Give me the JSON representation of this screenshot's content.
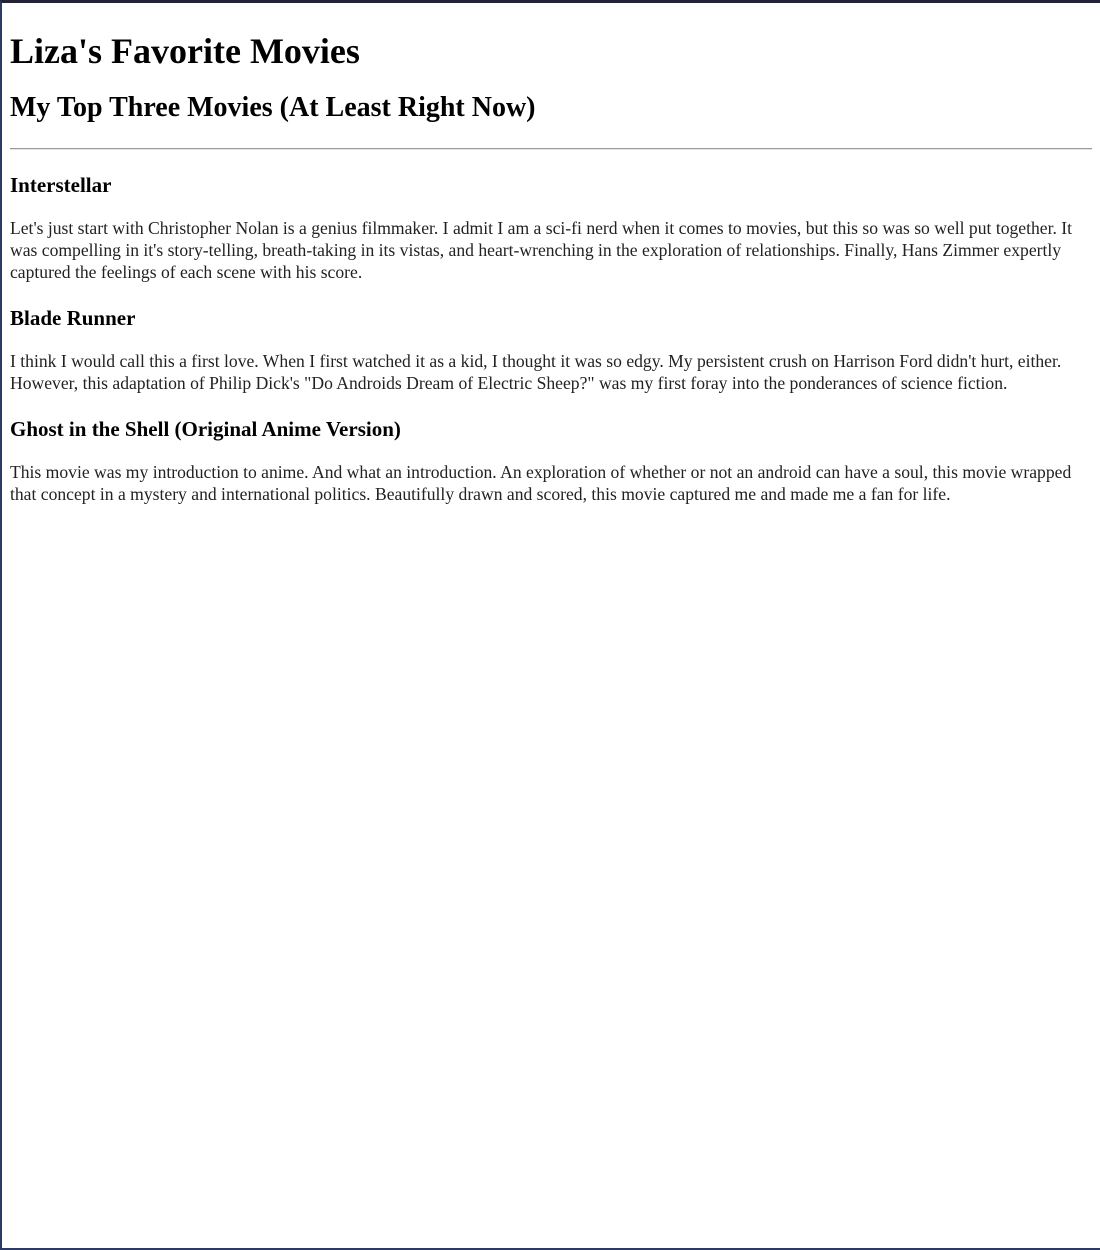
{
  "page": {
    "title": "Liza's Favorite Movies",
    "subtitle": "My Top Three Movies (At Least Right Now)"
  },
  "movies": [
    {
      "title": "Interstellar",
      "review": "Let's just start with Christopher Nolan is a genius filmmaker. I admit I am a sci-fi nerd when it comes to movies, but this so was so well put together. It was compelling in it's story-telling, breath-taking in its vistas, and heart-wrenching in the exploration of relationships. Finally, Hans Zimmer expertly captured the feelings of each scene with his score."
    },
    {
      "title": "Blade Runner",
      "review": "I think I would call this a first love. When I first watched it as a kid, I thought it was so edgy. My persistent crush on Harrison Ford didn't hurt, either. However, this adaptation of Philip Dick's \"Do Androids Dream of Electric Sheep?\" was my first foray into the ponderances of science fiction."
    },
    {
      "title": "Ghost in the Shell (Original Anime Version)",
      "review": "This movie was my introduction to anime. And what an introduction. An exploration of whether or not an android can have a soul, this movie wrapped that concept in a mystery and international politics. Beautifully drawn and scored, this movie captured me and made me a fan for life."
    }
  ]
}
